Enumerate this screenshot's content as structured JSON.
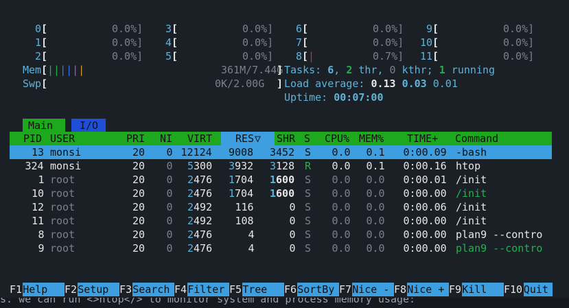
{
  "cpus": [
    {
      "num": "0",
      "pct": "0.0%]"
    },
    {
      "num": "1",
      "pct": "0.0%]"
    },
    {
      "num": "2",
      "pct": "0.0%]"
    },
    {
      "num": "3",
      "pct": "0.0%]"
    },
    {
      "num": "4",
      "pct": "0.0%]"
    },
    {
      "num": "5",
      "pct": "0.0%]"
    },
    {
      "num": "6",
      "pct": "0.0%]"
    },
    {
      "num": "7",
      "pct": "0.0%]"
    },
    {
      "num": "8",
      "pct": "0.7%]"
    },
    {
      "num": "9",
      "pct": "0.0%]"
    },
    {
      "num": "10",
      "pct": "0.0%]"
    },
    {
      "num": "11",
      "pct": "0.0%]"
    }
  ],
  "meters": {
    "mem_label": "Mem",
    "mem_bar": "||||||",
    "mem_value": "361M/7.44G",
    "swp_label": "Swp",
    "swp_value": "0K/2.00G"
  },
  "tasks": {
    "label": "Tasks: ",
    "tasks_count": "6",
    "sep1": ", ",
    "threads": "2",
    "thr_label": " thr",
    "sep2": ", ",
    "kthreads": "0",
    "kthr_label": " kthr; ",
    "running": "1",
    "running_label": " running",
    "load_label": "Load average: ",
    "load1": "0.13",
    "load5": "0.03",
    "load15": "0.01",
    "uptime_label": "Uptime: ",
    "uptime": "00:07:00"
  },
  "tabs": {
    "main": "Main",
    "io": "I/O"
  },
  "columns": {
    "pid": "PID",
    "user": "USER",
    "pri": "PRI",
    "ni": "NI",
    "virt": "VIRT",
    "res": "RES",
    "sort_indicator": "▽",
    "shr": "SHR",
    "s": "S",
    "cpu": "CPU%",
    "mem": "MEM%",
    "time": "TIME+",
    "command": "Command"
  },
  "processes": [
    {
      "pid": "13",
      "user": "monsi",
      "pri": "20",
      "ni": "0",
      "virt": "12124",
      "res": "9008",
      "shr": "3452",
      "s": "S",
      "cpu": "0.0",
      "mem": "0.1",
      "time": "0:00.09",
      "command": "-bash"
    },
    {
      "pid": "324",
      "user": "monsi",
      "pri": "20",
      "ni": "0",
      "virt": "5300",
      "res": "3932",
      "shr": "3128",
      "s": "R",
      "cpu": "0.0",
      "mem": "0.1",
      "time": "0:00.16",
      "command": "htop"
    },
    {
      "pid": "1",
      "user": "root",
      "pri": "20",
      "ni": "0",
      "virt": "2476",
      "res": "1704",
      "shr": "1600",
      "s": "S",
      "cpu": "0.0",
      "mem": "0.0",
      "time": "0:00.01",
      "command": "/init"
    },
    {
      "pid": "10",
      "user": "root",
      "pri": "20",
      "ni": "0",
      "virt": "2476",
      "res": "1704",
      "shr": "1600",
      "s": "S",
      "cpu": "0.0",
      "mem": "0.0",
      "time": "0:00.00",
      "command": "/init"
    },
    {
      "pid": "12",
      "user": "root",
      "pri": "20",
      "ni": "0",
      "virt": "2492",
      "res": "116",
      "shr": "0",
      "s": "S",
      "cpu": "0.0",
      "mem": "0.0",
      "time": "0:00.06",
      "command": "/init"
    },
    {
      "pid": "11",
      "user": "root",
      "pri": "20",
      "ni": "0",
      "virt": "2492",
      "res": "108",
      "shr": "0",
      "s": "S",
      "cpu": "0.0",
      "mem": "0.0",
      "time": "0:00.00",
      "command": "/init"
    },
    {
      "pid": "8",
      "user": "root",
      "pri": "20",
      "ni": "0",
      "virt": "2476",
      "res": "4",
      "shr": "0",
      "s": "S",
      "cpu": "0.0",
      "mem": "0.0",
      "time": "0:00.00",
      "command": "plan9 --contro"
    },
    {
      "pid": "9",
      "user": "root",
      "pri": "20",
      "ni": "0",
      "virt": "2476",
      "res": "4",
      "shr": "0",
      "s": "S",
      "cpu": "0.0",
      "mem": "0.0",
      "time": "0:00.00",
      "command": "plan9 --contro"
    }
  ],
  "fkeys": [
    {
      "num": "F1",
      "label": "Help  "
    },
    {
      "num": "F2",
      "label": "Setup "
    },
    {
      "num": "F3",
      "label": "Search"
    },
    {
      "num": "F4",
      "label": "Filter"
    },
    {
      "num": "F5",
      "label": "Tree  "
    },
    {
      "num": "F6",
      "label": "SortBy"
    },
    {
      "num": "F7",
      "label": "Nice -"
    },
    {
      "num": "F8",
      "label": "Nice +"
    },
    {
      "num": "F9",
      "label": "Kill  "
    },
    {
      "num": "F10",
      "label": "Quit"
    }
  ],
  "background_line": "s. we can run <>htop</> to monitor system and process memory usage:",
  "colors": {
    "background": "#1b2027",
    "header_bg": "#1ea81e",
    "selection_bg": "#3d9ee0",
    "io_tab_bg": "#1f4fd8",
    "cyan": "#5fb3d8",
    "green": "#22b14c",
    "red": "#d0342c"
  }
}
